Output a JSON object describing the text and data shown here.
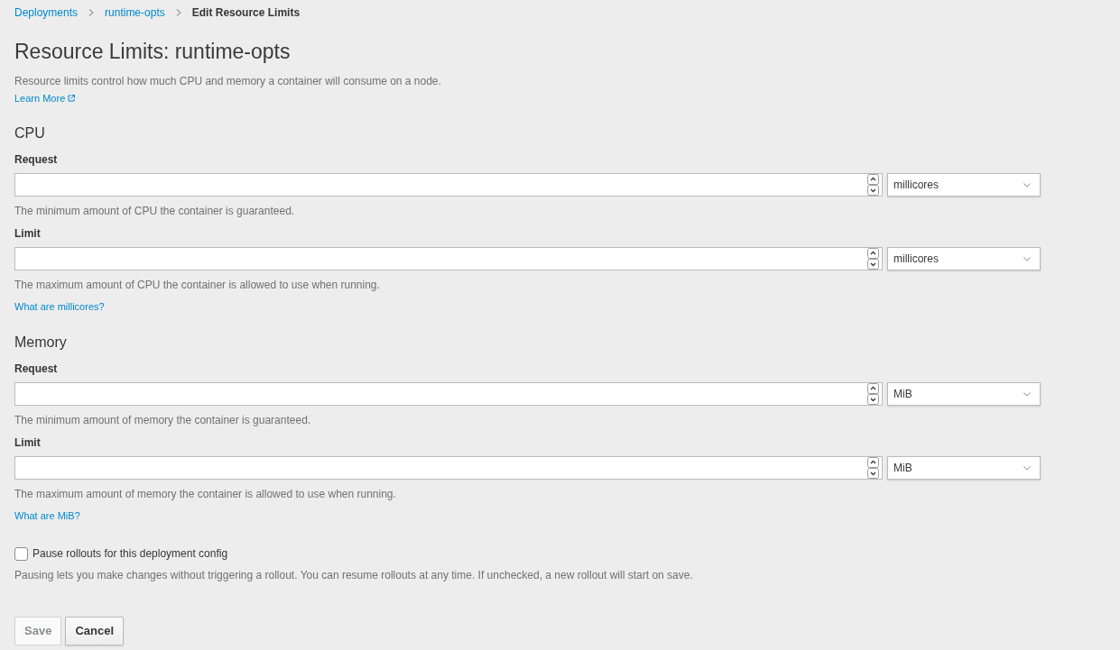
{
  "breadcrumb": [
    {
      "label": "Deployments",
      "kind": "link"
    },
    {
      "label": "runtime-opts",
      "kind": "link"
    },
    {
      "label": "Edit Resource Limits",
      "kind": "current"
    }
  ],
  "title": "Resource Limits: runtime-opts",
  "description": "Resource limits control how much CPU and memory a container will consume on a node.",
  "learn_more": "Learn More",
  "sections": [
    {
      "heading": "CPU",
      "fields": [
        {
          "label": "Request",
          "unit": "millicores",
          "help": "The minimum amount of CPU the container is guaranteed."
        },
        {
          "label": "Limit",
          "unit": "millicores",
          "help": "The maximum amount of CPU the container is allowed to use when running."
        }
      ],
      "help_link": "What are millicores?"
    },
    {
      "heading": "Memory",
      "fields": [
        {
          "label": "Request",
          "unit": "MiB",
          "help": "The minimum amount of memory the container is guaranteed."
        },
        {
          "label": "Limit",
          "unit": "MiB",
          "help": "The maximum amount of memory the container is allowed to use when running."
        }
      ],
      "help_link": "What are MiB?"
    }
  ],
  "pause": {
    "label": "Pause rollouts for this deployment config",
    "checked": false,
    "help": "Pausing lets you make changes without triggering a rollout. You can resume rollouts at any time. If unchecked, a new rollout will start on save."
  },
  "buttons": [
    {
      "label": "Save",
      "disabled": true
    },
    {
      "label": "Cancel",
      "disabled": false
    }
  ]
}
